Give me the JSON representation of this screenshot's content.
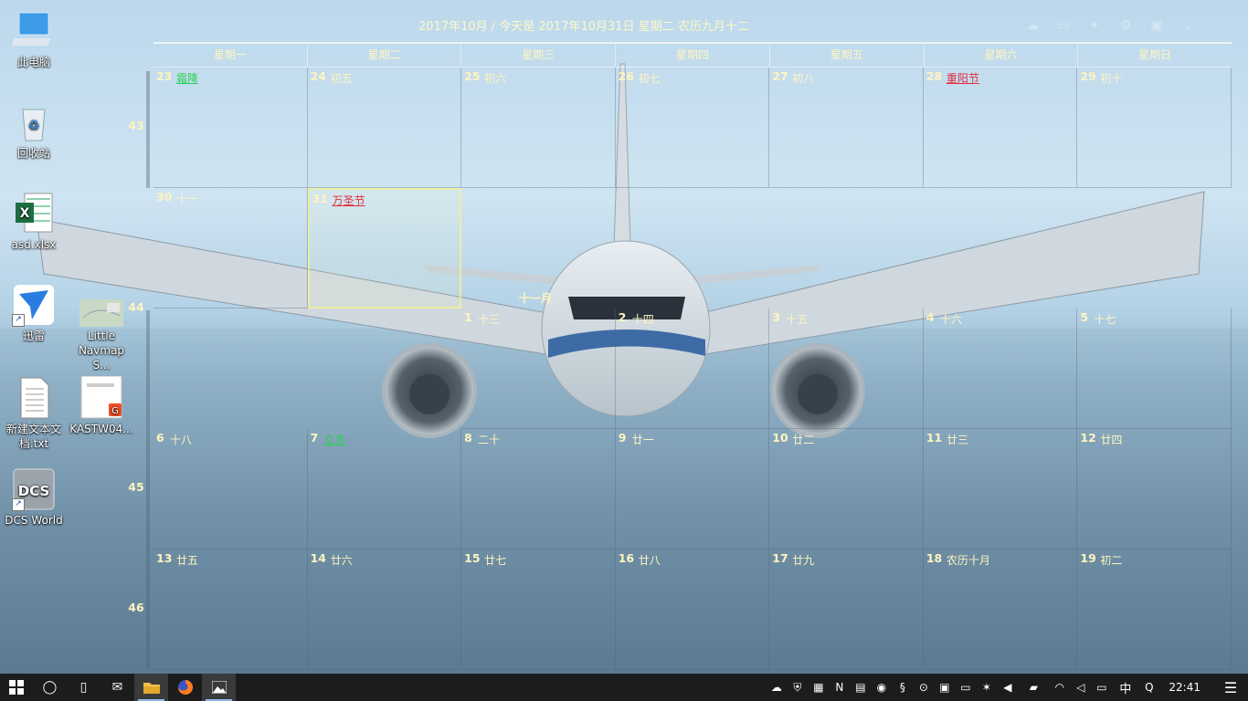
{
  "calendar": {
    "title": "2017年10月 / 今天是 2017年10月31日 星期二 农历九月十二",
    "weekdays": [
      "星期一",
      "星期二",
      "星期三",
      "星期四",
      "星期五",
      "星期六",
      "星期日"
    ],
    "week_numbers": [
      "43",
      "44",
      "45",
      "46"
    ],
    "month_label": "十一月",
    "weeks": [
      [
        {
          "day": "23",
          "lunar": "霜降",
          "style": "green"
        },
        {
          "day": "24",
          "lunar": "初五"
        },
        {
          "day": "25",
          "lunar": "初六"
        },
        {
          "day": "26",
          "lunar": "初七"
        },
        {
          "day": "27",
          "lunar": "初八"
        },
        {
          "day": "28",
          "lunar": "重阳节",
          "style": "red"
        },
        {
          "day": "29",
          "lunar": "初十"
        }
      ],
      [
        {
          "day": "30",
          "lunar": "十一"
        },
        {
          "day": "31",
          "lunar": "万圣节",
          "style": "red",
          "today": true
        }
      ],
      [
        {
          "day": "1",
          "lunar": "十三"
        },
        {
          "day": "2",
          "lunar": "十四"
        },
        {
          "day": "3",
          "lunar": "十五"
        },
        {
          "day": "4",
          "lunar": "十六"
        },
        {
          "day": "5",
          "lunar": "十七"
        }
      ],
      [
        {
          "day": "6",
          "lunar": "十八"
        },
        {
          "day": "7",
          "lunar": "立冬",
          "style": "green"
        },
        {
          "day": "8",
          "lunar": "二十"
        },
        {
          "day": "9",
          "lunar": "廿一"
        },
        {
          "day": "10",
          "lunar": "廿二"
        },
        {
          "day": "11",
          "lunar": "廿三"
        },
        {
          "day": "12",
          "lunar": "廿四"
        }
      ],
      [
        {
          "day": "13",
          "lunar": "廿五"
        },
        {
          "day": "14",
          "lunar": "廿六"
        },
        {
          "day": "15",
          "lunar": "廿七"
        },
        {
          "day": "16",
          "lunar": "廿八"
        },
        {
          "day": "17",
          "lunar": "廿九"
        },
        {
          "day": "18",
          "lunar": "农历十月"
        },
        {
          "day": "19",
          "lunar": "初二"
        }
      ]
    ]
  },
  "desktop_icons": [
    {
      "label": "此电脑",
      "icon": "computer-icon"
    },
    {
      "label": "回收站",
      "icon": "recycle-bin-icon"
    },
    {
      "label": "asd.xlsx",
      "icon": "excel-file-icon"
    },
    {
      "label": "迅雷",
      "icon": "thunder-icon"
    },
    {
      "label": "Little Navmap S...",
      "icon": "navmap-icon"
    },
    {
      "label": "新建文本文档.txt",
      "icon": "text-file-icon"
    },
    {
      "label": "KASTW04...",
      "icon": "pdf-file-icon"
    },
    {
      "label": "DCS World",
      "icon": "dcs-icon"
    }
  ],
  "taskbar": {
    "clock": "22:41",
    "ime": "中",
    "apps": [
      "start-icon",
      "search-icon",
      "task-view-icon",
      "mail-icon",
      "file-explorer-icon",
      "firefox-icon",
      "photos-icon"
    ]
  }
}
